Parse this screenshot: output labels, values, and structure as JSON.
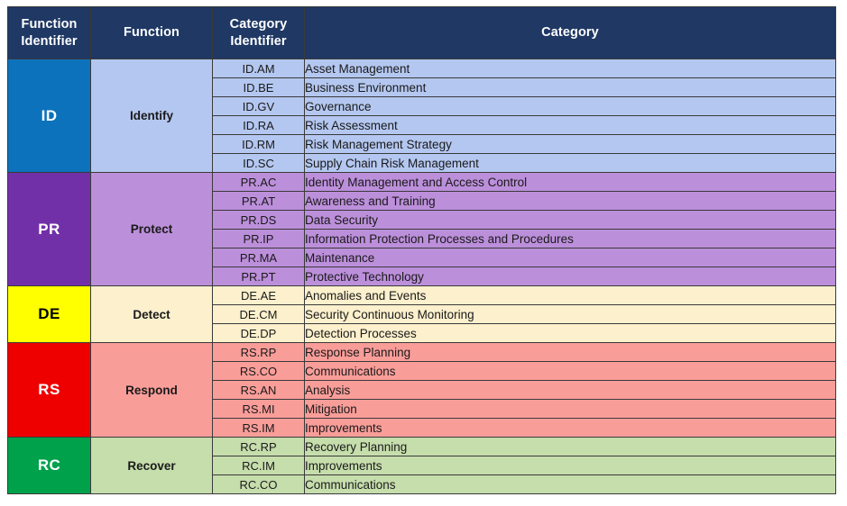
{
  "table": {
    "headers": {
      "function_identifier": "Function\nIdentifier",
      "function_identifier_line1": "Function",
      "function_identifier_line2": "Identifier",
      "function": "Function",
      "category_identifier_line1": "Category",
      "category_identifier_line2": "Identifier",
      "category": "Category"
    },
    "colors": {
      "header_background": "#1F3864",
      "header_text": "#FFFFFF",
      "border": "#3A3A3A",
      "identify_identifier": "#0C72BC",
      "identify_rows": "#B4C7F0",
      "protect_identifier": "#7130A8",
      "protect_rows": "#BC8FDB",
      "detect_identifier": "#FFFF00",
      "detect_rows": "#FCF0CD",
      "respond_identifier": "#EE0000",
      "respond_rows": "#F99D99",
      "recover_identifier": "#00A14B",
      "recover_rows": "#C6DDAC"
    },
    "functions": [
      {
        "identifier": "ID",
        "name": "Identify",
        "categories": [
          {
            "id": "ID.AM",
            "name": "Asset Management"
          },
          {
            "id": "ID.BE",
            "name": "Business Environment"
          },
          {
            "id": "ID.GV",
            "name": "Governance"
          },
          {
            "id": "ID.RA",
            "name": "Risk Assessment"
          },
          {
            "id": "ID.RM",
            "name": "Risk Management Strategy"
          },
          {
            "id": "ID.SC",
            "name": "Supply Chain Risk Management"
          }
        ]
      },
      {
        "identifier": "PR",
        "name": "Protect",
        "categories": [
          {
            "id": "PR.AC",
            "name": "Identity Management and Access Control"
          },
          {
            "id": "PR.AT",
            "name": "Awareness and Training"
          },
          {
            "id": "PR.DS",
            "name": "Data Security"
          },
          {
            "id": "PR.IP",
            "name": "Information Protection Processes and Procedures"
          },
          {
            "id": "PR.MA",
            "name": "Maintenance"
          },
          {
            "id": "PR.PT",
            "name": "Protective Technology"
          }
        ]
      },
      {
        "identifier": "DE",
        "name": "Detect",
        "categories": [
          {
            "id": "DE.AE",
            "name": "Anomalies and Events"
          },
          {
            "id": "DE.CM",
            "name": "Security Continuous Monitoring"
          },
          {
            "id": "DE.DP",
            "name": "Detection Processes"
          }
        ]
      },
      {
        "identifier": "RS",
        "name": "Respond",
        "categories": [
          {
            "id": "RS.RP",
            "name": "Response Planning"
          },
          {
            "id": "RS.CO",
            "name": "Communications"
          },
          {
            "id": "RS.AN",
            "name": "Analysis"
          },
          {
            "id": "RS.MI",
            "name": "Mitigation"
          },
          {
            "id": "RS.IM",
            "name": "Improvements"
          }
        ]
      },
      {
        "identifier": "RC",
        "name": "Recover",
        "categories": [
          {
            "id": "RC.RP",
            "name": "Recovery Planning"
          },
          {
            "id": "RC.IM",
            "name": "Improvements"
          },
          {
            "id": "RC.CO",
            "name": "Communications"
          }
        ]
      }
    ]
  }
}
